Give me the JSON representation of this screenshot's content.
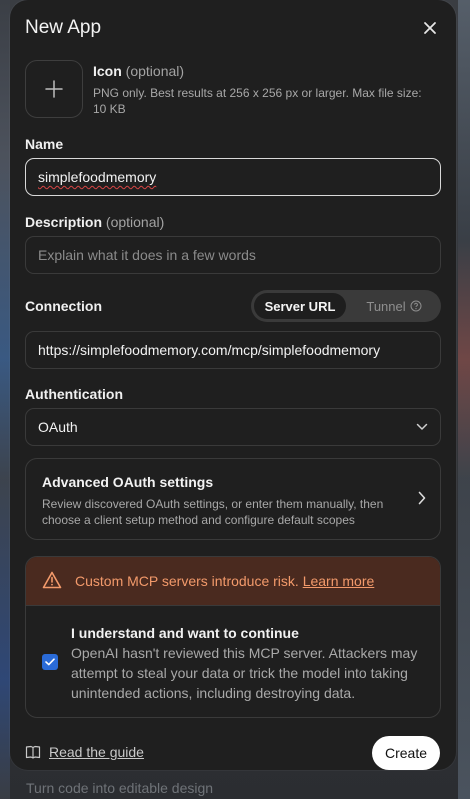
{
  "background": {
    "bottom_text": "Turn code into editable design"
  },
  "modal": {
    "title": "New App"
  },
  "icon_field": {
    "label": "Icon",
    "optional": "(optional)",
    "help": "PNG only. Best results at 256 x 256 px or larger. Max file size: 10 KB"
  },
  "name_field": {
    "label": "Name",
    "value": "simplefoodmemory"
  },
  "description_field": {
    "label": "Description",
    "optional": "(optional)",
    "placeholder": "Explain what it does in a few words"
  },
  "connection": {
    "label": "Connection",
    "tabs": [
      "Server URL",
      "Tunnel"
    ],
    "selected_tab": "Server URL",
    "url": "https://simplefoodmemory.com/mcp/simplefoodmemory"
  },
  "authentication": {
    "label": "Authentication",
    "selected": "OAuth"
  },
  "advanced": {
    "title": "Advanced OAuth settings",
    "description": "Review discovered OAuth settings, or enter them manually, then choose a client setup method and configure default scopes"
  },
  "risk": {
    "warning": "Custom MCP servers introduce risk.",
    "link": "Learn more",
    "ack_title": "I understand and want to continue",
    "ack_description": "OpenAI hasn't reviewed this MCP server. Attackers may attempt to steal your data or trick the model into taking unintended actions, including destroying data.",
    "checked": true
  },
  "footer": {
    "guide": "Read the guide",
    "create": "Create"
  },
  "colors": {
    "modal_bg": "#1f1f1f",
    "warning_bg": "#4a2a1f",
    "warning_text": "#f39a6b",
    "checkbox": "#2a6bd8",
    "primary_button": "#ffffff"
  }
}
